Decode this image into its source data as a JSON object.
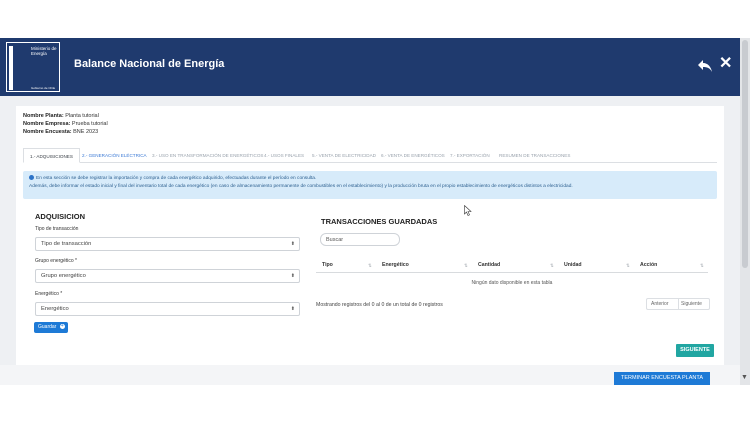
{
  "header": {
    "title": "Balance Nacional de Energía",
    "logo_line1": "Ministerio de Energía",
    "logo_line2": "Gobierno de Chile"
  },
  "meta": {
    "planta_label": "Nombre Planta:",
    "planta_value": "Planta tutorial",
    "empresa_label": "Nombre Empresa:",
    "empresa_value": "Prueba tutorial",
    "encuesta_label": "Nombre Encuesta:",
    "encuesta_value": "BNE 2023"
  },
  "tabs": [
    {
      "label": "1.- ADQUISICIONES"
    },
    {
      "label": "2.- GENERACIÓN ELÉCTRICA"
    },
    {
      "label": "3.- USO EN TRANSFORMACIÓN DE ENERGÉTICOS"
    },
    {
      "label": "4.- USOS FINALES"
    },
    {
      "label": "5.- VENTA DE ELECTRICIDAD"
    },
    {
      "label": "6.- VENTA DE ENERGÉTICOS"
    },
    {
      "label": "7.- EXPORTACIÓN"
    },
    {
      "label": "RESUMEN DE TRANSACCIONES"
    }
  ],
  "alert": {
    "line1": "En esta sección se debe registrar la importación y compra de cada energético adquirido, efectuadas durante el período en consulta.",
    "line2": "Además, debe informar el estado inicial y final del inventario total de cada energético (en caso de almacenamiento permanente de combustibles en el establecimiento) y la producción bruta en el propio establecimiento de energéticos distintos a electricidad."
  },
  "form": {
    "title": "ADQUISICION",
    "tipo_label": "Tipo de transacción",
    "tipo_value": "Tipo de transacción",
    "grupo_label": "Grupo energético *",
    "grupo_value": "Grupo energético",
    "energetico_label": "Energético *",
    "energetico_value": "Energético",
    "save_label": "Guardar",
    "save_icon_glyph": "+"
  },
  "saved": {
    "title": "TRANSACCIONES GUARDADAS",
    "search_placeholder": "Buscar",
    "columns": [
      "Tipo",
      "Energético",
      "Cantidad",
      "Unidad",
      "Acción"
    ],
    "empty": "Ningún dato disponible en esta tabla",
    "info": "Mostrando registros del 0 al 0 de un total de 0 registros",
    "prev_label": "Anterior",
    "next_label": "Siguiente"
  },
  "actions": {
    "next_label": "SIGUIENTE",
    "finish_label": "TERMINAR ENCUESTA PLANTA"
  },
  "colors": {
    "header_bg": "#1f3a6e",
    "primary_button": "#1e7ad6",
    "next_button": "#21a6a2",
    "alert_bg": "#d7ebfa"
  }
}
